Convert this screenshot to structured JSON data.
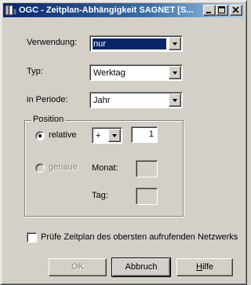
{
  "window": {
    "title": "OGC - Zeitplan-Abhängigkeit SAGNET [S..."
  },
  "form": {
    "verwendung_label": "Verwendung:",
    "verwendung_value": "nur",
    "typ_label": "Typ:",
    "typ_value": "Werktag",
    "periode_label": "in Periode:",
    "periode_value": "Jahr"
  },
  "position": {
    "group_label": "Position",
    "relative_label": "relative",
    "relative_selected": true,
    "sign_value": "+",
    "offset_value": "1",
    "genaue_label": "genaue",
    "monat_label": "Monat:",
    "tag_label": "Tag:"
  },
  "options": {
    "pruefe_label": "Prüfe Zeitplan des obersten aufrufenden Netzwerks",
    "pruefe_checked": false
  },
  "buttons": {
    "ok": "OK",
    "abbruch": "Abbruch",
    "hilfe_prefix": "H",
    "hilfe_rest": "ilfe"
  }
}
